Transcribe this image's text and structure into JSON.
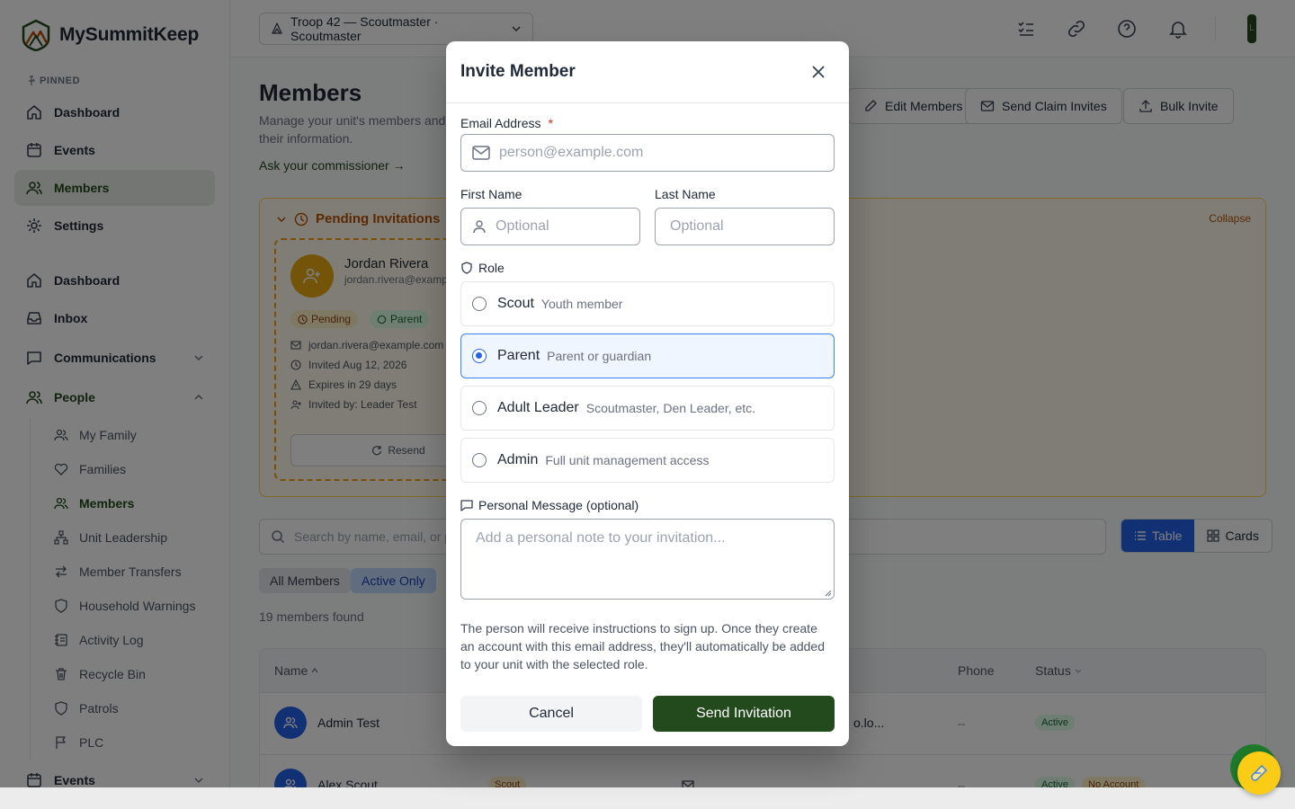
{
  "brand": {
    "name": "MySummitKeep"
  },
  "sidebar": {
    "pinned_label": "PINNED",
    "pinned": [
      {
        "label": "Dashboard",
        "icon": "home-icon"
      },
      {
        "label": "Events",
        "icon": "calendar-icon"
      },
      {
        "label": "Members",
        "icon": "users-icon",
        "active": true
      },
      {
        "label": "Settings",
        "icon": "gear-icon"
      }
    ],
    "main": [
      {
        "label": "Dashboard",
        "icon": "home-icon"
      },
      {
        "label": "Inbox",
        "icon": "inbox-icon"
      },
      {
        "label": "Communications",
        "icon": "message-icon",
        "chevron": "down"
      },
      {
        "label": "People",
        "icon": "users-icon",
        "chevron": "up",
        "active": true
      }
    ],
    "people_sub": [
      {
        "label": "My Family",
        "icon": "users-icon"
      },
      {
        "label": "Families",
        "icon": "heart-icon"
      },
      {
        "label": "Members",
        "icon": "users-icon",
        "active": true
      },
      {
        "label": "Unit Leadership",
        "icon": "org-chart-icon"
      },
      {
        "label": "Member Transfers",
        "icon": "transfer-icon"
      },
      {
        "label": "Household Warnings",
        "icon": "shield-icon"
      },
      {
        "label": "Activity Log",
        "icon": "activity-log-icon"
      },
      {
        "label": "Recycle Bin",
        "icon": "trash-icon"
      },
      {
        "label": "Patrols",
        "icon": "shield-icon"
      },
      {
        "label": "PLC",
        "icon": "flag-icon"
      }
    ],
    "events": {
      "label": "Events",
      "icon": "calendar-icon"
    }
  },
  "topbar": {
    "unit_selector": "Troop 42 — Scoutmaster · Scoutmaster",
    "avatar_letter": "L"
  },
  "page": {
    "title": "Members",
    "description": "Manage your unit's members and their information.",
    "ask_link": "Ask your commissioner →",
    "buttons": {
      "edit": "Edit Members",
      "claim": "Send Claim Invites",
      "bulk": "Bulk Invite"
    }
  },
  "pending": {
    "title": "Pending Invitations",
    "collapse": "Collapse",
    "card": {
      "name": "Jordan Rivera",
      "email_short": "jordan.rivera@exampl",
      "status": "Pending",
      "role": "Parent",
      "email": "jordan.rivera@example.com",
      "invited": "Invited Aug 12, 2026",
      "expires": "Expires in 29 days",
      "invited_by": "Invited by: Leader Test",
      "resend": "Resend"
    }
  },
  "search": {
    "placeholder": "Search by name, email, or ph"
  },
  "view_toggle": {
    "table": "Table",
    "cards": "Cards",
    "active": "table"
  },
  "filters": {
    "all": "All Members",
    "active": "Active Only"
  },
  "count": "19 members found",
  "table": {
    "columns": {
      "name": "Name",
      "phone": "Phone",
      "status": "Status"
    },
    "rows": [
      {
        "name": "Admin Test",
        "email_tail": "o.lo...",
        "phone": "--",
        "status": "Active"
      },
      {
        "name": "Alex Scout",
        "role": "Scout",
        "phone": "--",
        "status": "Active",
        "account": "No Account"
      }
    ]
  },
  "modal": {
    "title": "Invite Member",
    "email_label": "Email Address",
    "required_mark": "*",
    "email_placeholder": "person@example.com",
    "first_name_label": "First Name",
    "first_name_placeholder": "Optional",
    "last_name_label": "Last Name",
    "last_name_placeholder": "Optional",
    "role_label": "Role",
    "roles": [
      {
        "name": "Scout",
        "desc": "Youth member",
        "selected": false
      },
      {
        "name": "Parent",
        "desc": "Parent or guardian",
        "selected": true
      },
      {
        "name": "Adult Leader",
        "desc": "Scoutmaster, Den Leader, etc.",
        "selected": false
      },
      {
        "name": "Admin",
        "desc": "Full unit management access",
        "selected": false
      }
    ],
    "message_label": "Personal Message (optional)",
    "message_placeholder": "Add a personal note to your invitation...",
    "help_text": "The person will receive instructions to sign up. Once they create an account with this email address, they'll automatically be added to your unit with the selected role.",
    "cancel": "Cancel",
    "send": "Send Invitation"
  },
  "colors": {
    "brand_green": "#234a1c",
    "accent_blue": "#2563eb",
    "amber": "#b45309"
  }
}
